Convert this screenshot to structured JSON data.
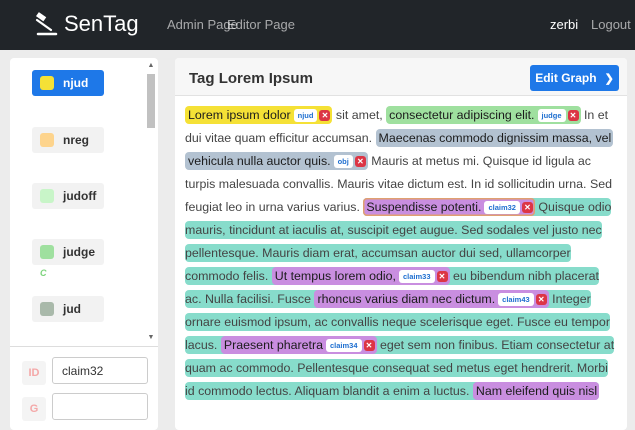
{
  "app": {
    "brand": "SenTag"
  },
  "nav": {
    "admin_page": "Admin Page",
    "editor_page": "Editor Page",
    "user": "zerbi",
    "logout": "Logout"
  },
  "labels": [
    {
      "name": "njud",
      "color": "#f5e136",
      "active": true
    },
    {
      "name": "nreg",
      "color": "#fdd48d",
      "active": false
    },
    {
      "name": "judoff",
      "color": "#c8f5c8",
      "active": false
    },
    {
      "name": "judge",
      "color": "#9fe09f",
      "active": false,
      "shortcut": "C"
    },
    {
      "name": "jud",
      "color": "#a9b9aa",
      "active": false
    }
  ],
  "fields": {
    "id": {
      "label": "ID",
      "value": "claim32"
    },
    "g": {
      "label": "G",
      "value": ""
    }
  },
  "main": {
    "title": "Tag Lorem Ipsum",
    "edit_button": "Edit Graph"
  },
  "colors": {
    "njud": "#f5e136",
    "judge": "#9fe09f",
    "obj": "#b3c2d1",
    "claim": "#c98ee0",
    "claim_ext": "#87dccb",
    "primary": "#1e78e8",
    "navbar": "#212529"
  },
  "text": {
    "a1": "Lorem ipsum dolor",
    "a1_tag": "njud",
    "s1": " sit amet, ",
    "a2": "consectetur adipiscing elit.",
    "a2_tag": "judge",
    "s2": " In et dui vitae quam efficitur accumsan. ",
    "a3": "Maecenas commodo dignissim massa, vel vehicula nulla auctor quis.",
    "a3_tag": "obj",
    "s3": " Mauris at metus mi. Quisque id ligula ac turpis malesuada convallis. Mauris vitae dictum est. In id sollicitudin urna. Sed feugiat leo in urna varius varius. ",
    "a4": "Suspendisse potenti.",
    "a4_tag": "claim32",
    "s4": " Quisque odio mauris, tincidunt at iaculis at, suscipit eget augue. Sed sodales vel justo nec pellentesque. Mauris diam erat, accumsan auctor dui sed, ullamcorper commodo felis. ",
    "a5": "Ut tempus lorem odio,",
    "a5_tag": "claim33",
    "s5": " eu bibendum nibh placerat ac. Nulla facilisi. Fusce ",
    "a6": "rhoncus varius diam nec dictum.",
    "a6_tag": "claim43",
    "s6": " Integer ornare euismod ipsum, ac convallis neque scelerisque eget.  Fusce eu tempor lacus. ",
    "a7": "Praesent pharetra",
    "a7_tag": "claim34",
    "s7": " eget sem non finibus. Etiam consectetur at quam ac commodo. Pellentesque consequat sed metus eget hendrerit. Morbi id commodo lectus. Aliquam blandit a enim a luctus. ",
    "a8": "Nam eleifend quis nisl"
  }
}
